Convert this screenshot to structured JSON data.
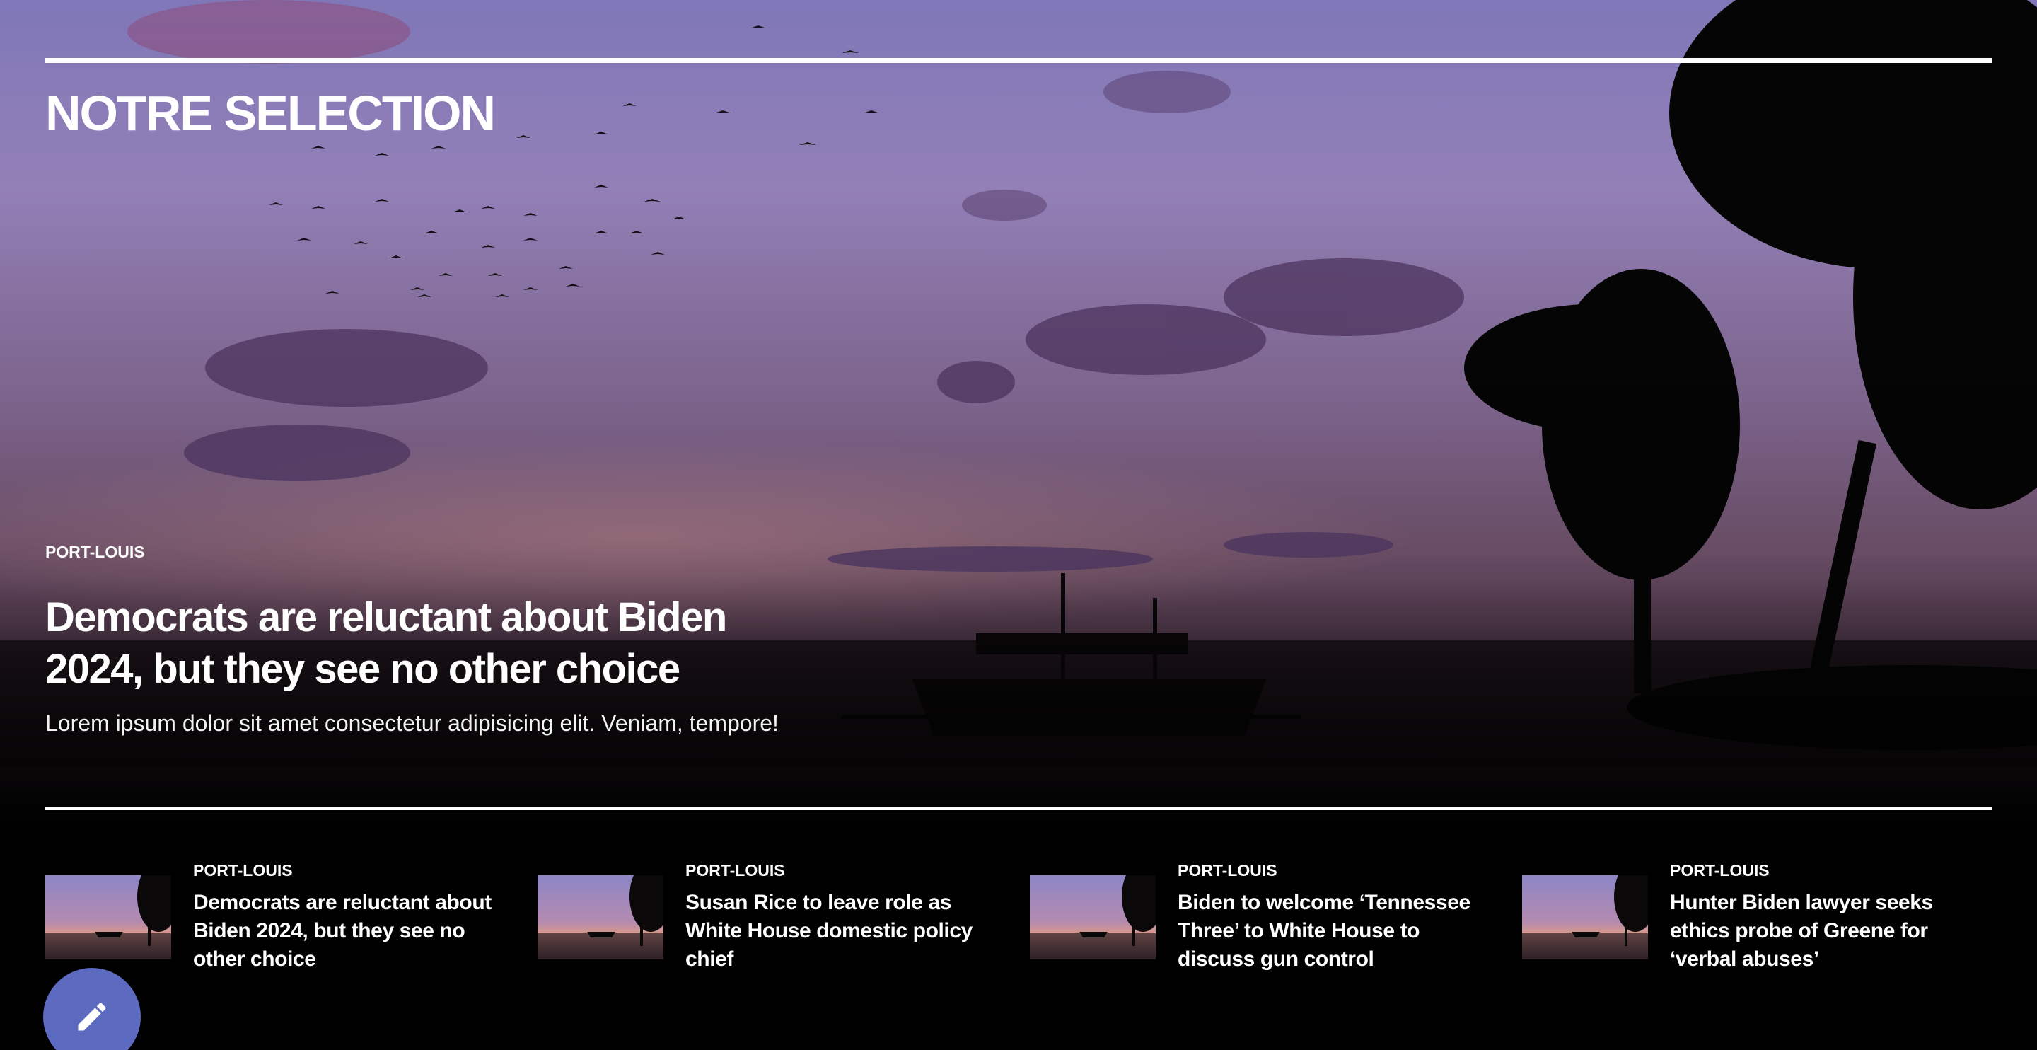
{
  "section": {
    "title": "NOTRE SELECTION"
  },
  "featured": {
    "category": "PORT-LOUIS",
    "title": "Democrats are reluctant about Biden 2024, but they see no other choice",
    "description": "Lorem ipsum dolor sit amet consectetur adipisicing elit. Veniam, tempore!"
  },
  "articles": [
    {
      "category": "PORT-LOUIS",
      "title": "Democrats are reluctant about Biden 2024, but they see no other choice"
    },
    {
      "category": "PORT-LOUIS",
      "title": "Susan Rice to leave role as White House domestic policy chief"
    },
    {
      "category": "PORT-LOUIS",
      "title": "Biden to welcome ‘Tennessee Three’ to White House to discuss gun control"
    },
    {
      "category": "PORT-LOUIS",
      "title": "Hunter Biden lawyer seeks ethics probe of Greene for ‘verbal abuses’"
    }
  ],
  "fab": {
    "icon": "pencil-icon",
    "color": "#5c6bc0"
  },
  "colors": {
    "sky_top": "#8f85c4",
    "sky_mid": "#a785b6",
    "horizon": "#c58a86",
    "dark": "#000000"
  }
}
